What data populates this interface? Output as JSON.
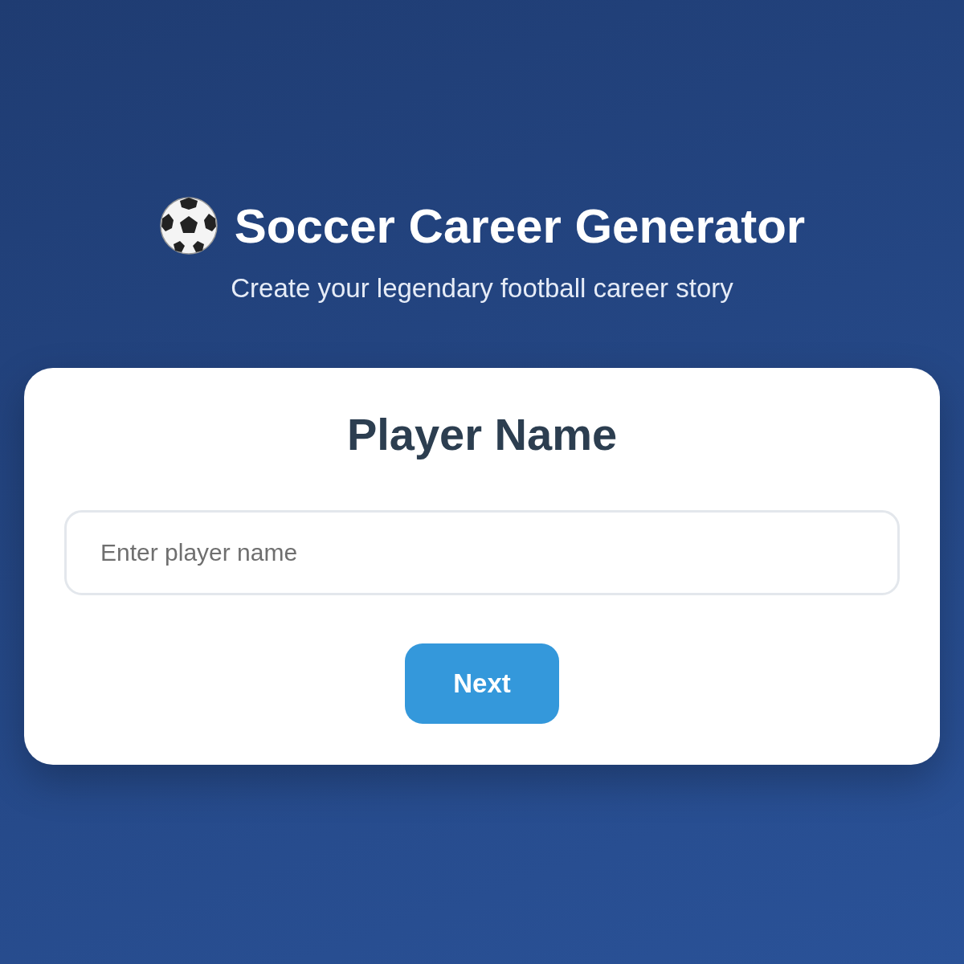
{
  "header": {
    "title": "Soccer Career Generator",
    "subtitle": "Create your legendary football career story"
  },
  "card": {
    "heading": "Player Name",
    "field": {
      "placeholder": "Enter player name"
    },
    "button": "Next"
  }
}
